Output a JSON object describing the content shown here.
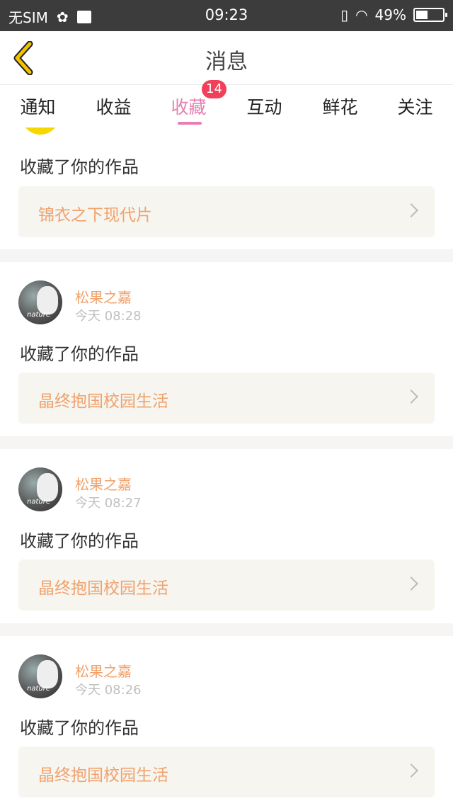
{
  "status_bar": {
    "carrier": "无SIM",
    "time": "09:23",
    "battery": "49%"
  },
  "header": {
    "title": "消息"
  },
  "tabs": [
    {
      "label": "通知"
    },
    {
      "label": "收益"
    },
    {
      "label": "收藏",
      "badge": "14"
    },
    {
      "label": "互动"
    },
    {
      "label": "鲜花"
    },
    {
      "label": "关注"
    }
  ],
  "feed": [
    {
      "action": "收藏了你的作品",
      "work_title": "锦衣之下现代片"
    },
    {
      "username": "松果之嘉",
      "timestamp": "今天 08:28",
      "action": "收藏了你的作品",
      "work_title": "晶终抱国校园生活"
    },
    {
      "username": "松果之嘉",
      "timestamp": "今天 08:27",
      "action": "收藏了你的作品",
      "work_title": "晶终抱国校园生活"
    },
    {
      "username": "松果之嘉",
      "timestamp": "今天 08:26",
      "action": "收藏了你的作品",
      "work_title": "晶终抱国校园生活"
    }
  ],
  "colors": {
    "accent": "#e77eb0",
    "badge": "#f0405a",
    "username": "#f0a26d",
    "back_arrow": "#f2c200"
  }
}
